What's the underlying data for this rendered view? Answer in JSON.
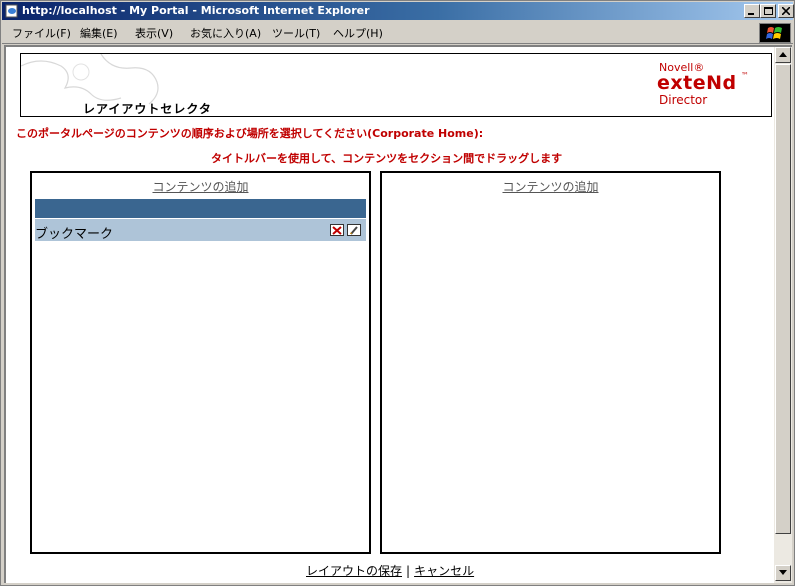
{
  "window": {
    "title": "http://localhost - My Portal - Microsoft Internet Explorer",
    "minimize": "_",
    "maximize": "□",
    "close": "×"
  },
  "menu": {
    "items": [
      "ファイル(F)",
      "編集(E)",
      "表示(V)",
      "お気に入り(A)",
      "ツール(T)",
      "ヘルプ(H)"
    ]
  },
  "banner": {
    "title": "レアイアウトセレクタ",
    "logo_line1": "Novell®",
    "logo_line2": "exteNd",
    "logo_tm": "™",
    "logo_line3": "Director"
  },
  "instructions": {
    "line1": "このポータルページのコンテンツの順序および場所を選択してください(Corporate Home):",
    "line2": "タイトルバーを使用して、コンテンツをセクション間でドラッグします"
  },
  "columns": [
    {
      "add_content": "コンテンツの追加",
      "portlets": [
        {
          "title": "ブックマーク"
        }
      ]
    },
    {
      "add_content": "コンテンツの追加",
      "portlets": []
    }
  ],
  "footer": {
    "save_layout": "レイアウトの保存",
    "separator": "|",
    "cancel": "キャンセル"
  },
  "colors": {
    "accent_red": "#c00000",
    "section_bar": "#3a6690",
    "portlet_bar": "#aec4d8"
  }
}
